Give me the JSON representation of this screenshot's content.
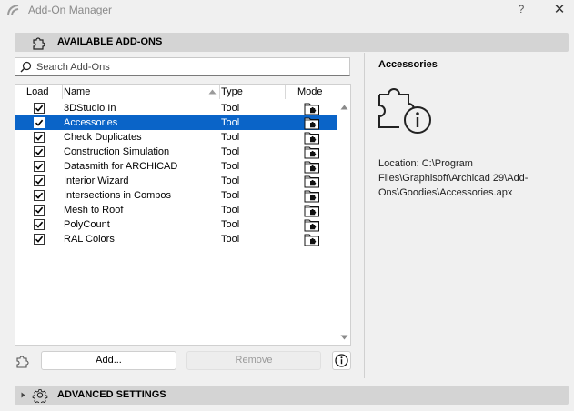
{
  "window": {
    "title": "Add-On Manager",
    "help_label": "?",
    "close_label": "✕"
  },
  "available_section": {
    "label": "AVAILABLE ADD-ONS"
  },
  "search": {
    "placeholder": "Search Add-Ons",
    "value": ""
  },
  "table": {
    "columns": {
      "load": "Load",
      "name": "Name",
      "type": "Type",
      "mode": "Mode"
    },
    "rows": [
      {
        "name": "3DStudio In",
        "type": "Tool",
        "loaded": true,
        "selected": false
      },
      {
        "name": "Accessories",
        "type": "Tool",
        "loaded": true,
        "selected": true
      },
      {
        "name": "Check Duplicates",
        "type": "Tool",
        "loaded": true,
        "selected": false
      },
      {
        "name": "Construction Simulation",
        "type": "Tool",
        "loaded": true,
        "selected": false
      },
      {
        "name": "Datasmith for ARCHICAD",
        "type": "Tool",
        "loaded": true,
        "selected": false
      },
      {
        "name": "Interior Wizard",
        "type": "Tool",
        "loaded": true,
        "selected": false
      },
      {
        "name": "Intersections in Combos",
        "type": "Tool",
        "loaded": true,
        "selected": false
      },
      {
        "name": "Mesh to Roof",
        "type": "Tool",
        "loaded": true,
        "selected": false
      },
      {
        "name": "PolyCount",
        "type": "Tool",
        "loaded": true,
        "selected": false
      },
      {
        "name": "RAL Colors",
        "type": "Tool",
        "loaded": true,
        "selected": false
      }
    ]
  },
  "buttons": {
    "add": "Add...",
    "remove": "Remove"
  },
  "details": {
    "title": "Accessories",
    "location": "Location: C:\\Program Files\\Graphisoft\\Archicad 29\\Add-Ons\\Goodies\\Accessories.apx"
  },
  "advanced_section": {
    "label": "ADVANCED SETTINGS"
  },
  "icons": {
    "app": "archicad-logo-icon",
    "section": "puzzle-icon",
    "search": "search-icon",
    "mode": "folder-puzzle-icon",
    "info": "info-icon",
    "details": "puzzle-info-icon",
    "advanced": "gear-icon"
  },
  "colors": {
    "selection": "#0a64c8",
    "section_bar": "#d4d4d4",
    "background": "#f0f0f0"
  }
}
